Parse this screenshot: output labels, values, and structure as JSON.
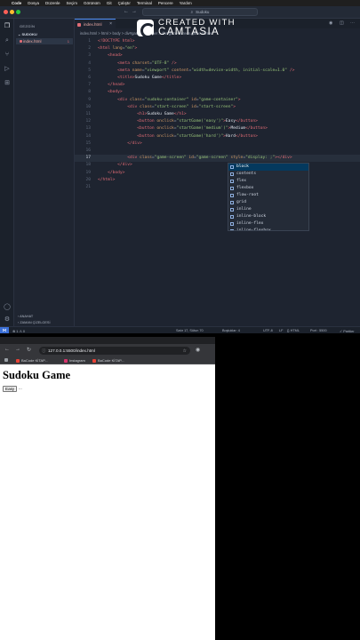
{
  "menubar": {
    "apple": "",
    "items": [
      "Code",
      "Dosya",
      "Düzenle",
      "Seçim",
      "Görünüm",
      "Git",
      "Çalıştır",
      "Terminal",
      "Pencere",
      "Yardım"
    ]
  },
  "vscode": {
    "command_center": "Sudoku",
    "sidebar": {
      "title": "GEZGİN",
      "folder": "SUDOKU",
      "file": "index.html",
      "file_problems": "1",
      "outline": "ANAHAT",
      "timeline": "ZAMAN ÇİZELGESİ"
    },
    "tab": {
      "label": "index.html"
    },
    "breadcrumb": "index.html > html > body > div#game-container > div#game-screen.game-screen",
    "code_lines": [
      {
        "n": "1",
        "active": false,
        "tokens": [
          [
            "t-tag",
            "<!DOCTYPE html>"
          ]
        ]
      },
      {
        "n": "2",
        "active": false,
        "tokens": [
          [
            "t-tag",
            "<html "
          ],
          [
            "t-attr",
            "lang"
          ],
          [
            "t-pun",
            "="
          ],
          [
            "t-str",
            "\"en\""
          ],
          [
            "t-tag",
            ">"
          ]
        ]
      },
      {
        "n": "3",
        "active": false,
        "tokens": [
          [
            "t-txt",
            "    "
          ],
          [
            "t-tag",
            "<head>"
          ]
        ]
      },
      {
        "n": "4",
        "active": false,
        "tokens": [
          [
            "t-txt",
            "        "
          ],
          [
            "t-tag",
            "<meta "
          ],
          [
            "t-attr",
            "charset"
          ],
          [
            "t-pun",
            "="
          ],
          [
            "t-str",
            "\"UTF-8\""
          ],
          [
            "t-tag",
            " />"
          ]
        ]
      },
      {
        "n": "5",
        "active": false,
        "tokens": [
          [
            "t-txt",
            "        "
          ],
          [
            "t-tag",
            "<meta "
          ],
          [
            "t-attr",
            "name"
          ],
          [
            "t-pun",
            "="
          ],
          [
            "t-str",
            "\"viewport\""
          ],
          [
            "t-attr",
            " content"
          ],
          [
            "t-pun",
            "="
          ],
          [
            "t-str",
            "\"width=device-width, initial-scale=1.0\""
          ],
          [
            "t-tag",
            " />"
          ]
        ]
      },
      {
        "n": "6",
        "active": false,
        "tokens": [
          [
            "t-txt",
            "        "
          ],
          [
            "t-tag",
            "<title>"
          ],
          [
            "t-txt",
            "Sudoku Game"
          ],
          [
            "t-tag",
            "</title>"
          ]
        ]
      },
      {
        "n": "7",
        "active": false,
        "tokens": [
          [
            "t-txt",
            "    "
          ],
          [
            "t-tag",
            "</head>"
          ]
        ]
      },
      {
        "n": "8",
        "active": false,
        "tokens": [
          [
            "t-txt",
            "    "
          ],
          [
            "t-tag",
            "<body>"
          ]
        ]
      },
      {
        "n": "9",
        "active": false,
        "tokens": [
          [
            "t-txt",
            "        "
          ],
          [
            "t-tag",
            "<div "
          ],
          [
            "t-attr",
            "class"
          ],
          [
            "t-pun",
            "="
          ],
          [
            "t-str",
            "\"sudoku-container\""
          ],
          [
            "t-attr",
            " id"
          ],
          [
            "t-pun",
            "="
          ],
          [
            "t-str",
            "\"game-container\""
          ],
          [
            "t-tag",
            ">"
          ]
        ]
      },
      {
        "n": "10",
        "active": false,
        "tokens": [
          [
            "t-txt",
            "            "
          ],
          [
            "t-tag",
            "<div "
          ],
          [
            "t-attr",
            "class"
          ],
          [
            "t-pun",
            "="
          ],
          [
            "t-str",
            "\"start-screen\""
          ],
          [
            "t-attr",
            " id"
          ],
          [
            "t-pun",
            "="
          ],
          [
            "t-str",
            "\"start-screen\""
          ],
          [
            "t-tag",
            ">"
          ]
        ]
      },
      {
        "n": "11",
        "active": false,
        "tokens": [
          [
            "t-txt",
            "                "
          ],
          [
            "t-tag",
            "<h1>"
          ],
          [
            "t-txt",
            "Sudoku Game"
          ],
          [
            "t-tag",
            "</h1>"
          ]
        ]
      },
      {
        "n": "12",
        "active": false,
        "tokens": [
          [
            "t-txt",
            "                "
          ],
          [
            "t-tag",
            "<button "
          ],
          [
            "t-attr",
            "onclick"
          ],
          [
            "t-pun",
            "="
          ],
          [
            "t-str",
            "\"startGame('easy')\""
          ],
          [
            "t-tag",
            ">"
          ],
          [
            "t-txt",
            "Easy"
          ],
          [
            "t-tag",
            "</button>"
          ]
        ]
      },
      {
        "n": "13",
        "active": false,
        "tokens": [
          [
            "t-txt",
            "                "
          ],
          [
            "t-tag",
            "<button "
          ],
          [
            "t-attr",
            "onclick"
          ],
          [
            "t-pun",
            "="
          ],
          [
            "t-str",
            "\"startGame('medium')\""
          ],
          [
            "t-tag",
            ">"
          ],
          [
            "t-txt",
            "Medium"
          ],
          [
            "t-tag",
            "</button>"
          ]
        ]
      },
      {
        "n": "14",
        "active": false,
        "tokens": [
          [
            "t-txt",
            "                "
          ],
          [
            "t-tag",
            "<button "
          ],
          [
            "t-attr",
            "onclick"
          ],
          [
            "t-pun",
            "="
          ],
          [
            "t-str",
            "\"startGame('hard')\""
          ],
          [
            "t-tag",
            ">"
          ],
          [
            "t-txt",
            "Hard"
          ],
          [
            "t-tag",
            "</button>"
          ]
        ]
      },
      {
        "n": "15",
        "active": false,
        "tokens": [
          [
            "t-txt",
            "            "
          ],
          [
            "t-tag",
            "</div>"
          ]
        ]
      },
      {
        "n": "16",
        "active": false,
        "tokens": []
      },
      {
        "n": "17",
        "active": true,
        "tokens": [
          [
            "t-txt",
            "            "
          ],
          [
            "t-tag",
            "<div "
          ],
          [
            "t-attr",
            "class"
          ],
          [
            "t-pun",
            "="
          ],
          [
            "t-str",
            "\"game-screen\""
          ],
          [
            "t-attr",
            " id"
          ],
          [
            "t-pun",
            "="
          ],
          [
            "t-str",
            "\"game-screen\""
          ],
          [
            "t-attr",
            " style"
          ],
          [
            "t-pun",
            "="
          ],
          [
            "t-str",
            "\"display: ;\""
          ],
          [
            "t-tag",
            "></div>"
          ]
        ]
      },
      {
        "n": "18",
        "active": false,
        "tokens": [
          [
            "t-txt",
            "        "
          ],
          [
            "t-tag",
            "</div>"
          ]
        ]
      },
      {
        "n": "19",
        "active": false,
        "tokens": [
          [
            "t-txt",
            "    "
          ],
          [
            "t-tag",
            "</body>"
          ]
        ]
      },
      {
        "n": "20",
        "active": false,
        "tokens": [
          [
            "t-tag",
            "</html>"
          ]
        ]
      },
      {
        "n": "21",
        "active": false,
        "tokens": []
      }
    ],
    "suggestions": [
      "block",
      "contents",
      "flex",
      "flexbox",
      "flow-root",
      "grid",
      "inline",
      "inline-block",
      "inline-flex",
      "inline-flexbox"
    ],
    "selected_suggestion": "block",
    "status": {
      "left": "⊗ 1 ⚠ 0",
      "position": "Satır 17, Sütun 70",
      "spaces": "Boşluklar: 4",
      "encoding": "UTF-8",
      "eol": "LF",
      "language": "{} HTML",
      "port": "Port : 5500",
      "prettier": "✓ Prettier"
    }
  },
  "watermark": {
    "line1": "CREATED WITH",
    "line2": "CAMTASIA"
  },
  "browser": {
    "url": "127.0.0.1:5500/index.html",
    "bookmarks": [
      "BaCode KİTAP...",
      "Instagram",
      "BaCode KİTAP..."
    ],
    "page": {
      "heading": "Sudoku Game",
      "buttons": [
        "Easy",
        "..."
      ]
    }
  },
  "colors": {
    "accent": "#4c8df6",
    "editor_bg": "#1e2430",
    "tag": "#e06c75",
    "attr": "#d19a66",
    "string": "#98c379"
  }
}
